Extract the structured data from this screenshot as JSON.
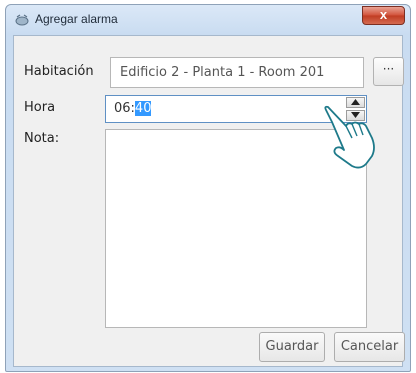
{
  "window": {
    "title": "Agregar alarma",
    "close_label": "x"
  },
  "form": {
    "room_label": "Habitación",
    "room_value": "Edificio 2 - Planta 1 - Room 201",
    "browse_label": "···",
    "time_label": "Hora",
    "time_hours": "06:",
    "time_minutes_selected": "40",
    "note_label": "Nota:",
    "note_value": ""
  },
  "buttons": {
    "save": "Guardar",
    "cancel": "Cancelar"
  }
}
